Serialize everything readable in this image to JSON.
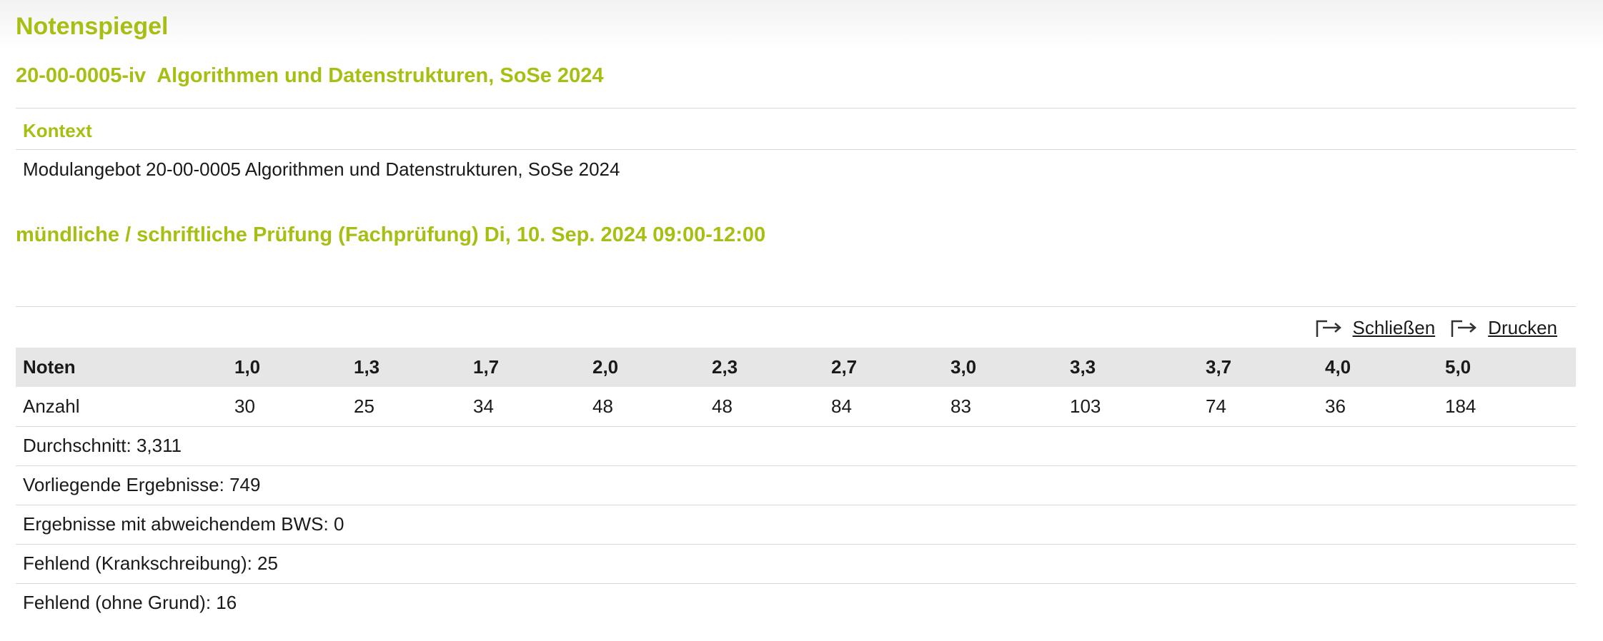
{
  "page": {
    "title": "Notenspiegel",
    "course_title": "20-00-0005-iv  Algorithmen und Datenstrukturen, SoSe 2024"
  },
  "context": {
    "heading": "Kontext",
    "value": "Modulangebot 20-00-0005 Algorithmen und Datenstrukturen, SoSe 2024"
  },
  "exam": {
    "title": "mündliche / schriftliche Prüfung (Fachprüfung) Di, 10. Sep. 2024 09:00-12:00"
  },
  "actions": {
    "close_label": "Schließen",
    "print_label": "Drucken"
  },
  "grades_table": {
    "row_header": "Noten",
    "count_header": "Anzahl",
    "grades": [
      "1,0",
      "1,3",
      "1,7",
      "2,0",
      "2,3",
      "2,7",
      "3,0",
      "3,3",
      "3,7",
      "4,0",
      "5,0"
    ],
    "counts": [
      "30",
      "25",
      "34",
      "48",
      "48",
      "84",
      "83",
      "103",
      "74",
      "36",
      "184"
    ]
  },
  "stats": {
    "average": "Durchschnitt: 3,311",
    "results": "Vorliegende Ergebnisse: 749",
    "deviating_bws": "Ergebnisse mit abweichendem BWS: 0",
    "missing_sick": "Fehlend (Krankschreibung): 25",
    "missing_no_reason": "Fehlend (ohne Grund): 16"
  },
  "colors": {
    "accent": "#a8be12",
    "header_bg": "#e6e6e6",
    "rule": "#d8d8d8"
  },
  "icons": {
    "action_icon": "arrow-right-bracket-icon"
  }
}
